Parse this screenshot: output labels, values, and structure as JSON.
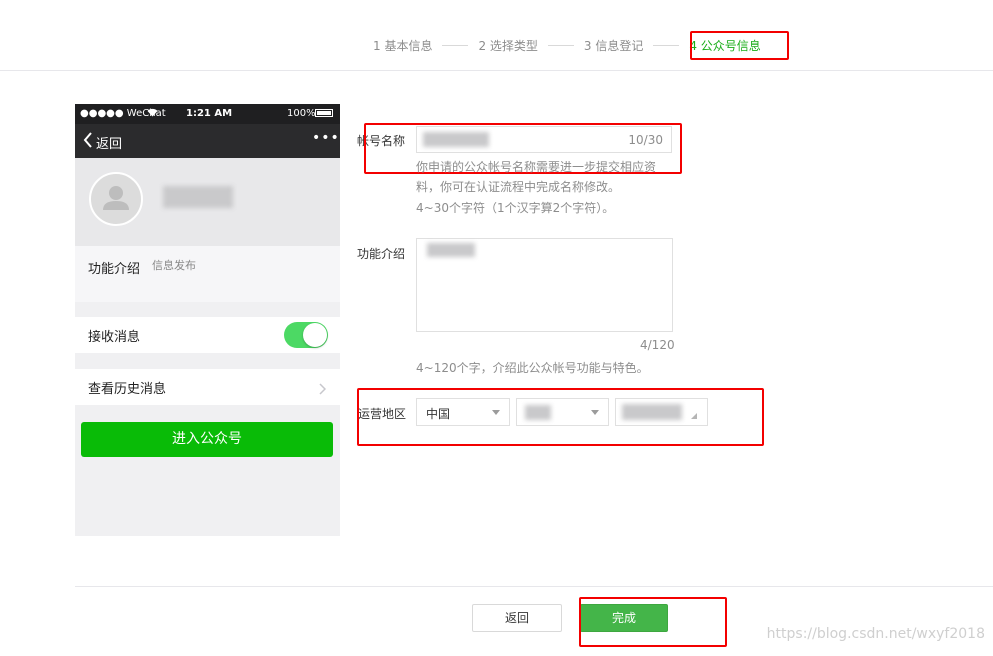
{
  "stepper": {
    "steps": [
      "1 基本信息",
      "2 选择类型",
      "3 信息登记",
      "4 公众号信息"
    ],
    "active_index": 3,
    "active_color": "#1aad19"
  },
  "phone": {
    "status_bar": {
      "carrier": "●●●●● WeChat",
      "time": "1:21 AM",
      "battery": "100%"
    },
    "nav": {
      "back_label": "返回",
      "more_icon": "more-icon"
    },
    "intro_label": "功能介绍",
    "intro_value": "信息发布",
    "receive_label": "接收消息",
    "receive_enabled": true,
    "history_label": "查看历史消息",
    "enter_button": "进入公众号"
  },
  "form": {
    "name_label": "帐号名称",
    "name_counter": "10/30",
    "name_hint_1": "你申请的公众帐号名称需要进一步提交相应资",
    "name_hint_2": "料，你可在认证流程中完成名称修改。",
    "name_rule": "4~30个字符（1个汉字算2个字符）。",
    "intro_label": "功能介绍",
    "intro_counter": "4/120",
    "intro_hint": "4~120个字，介绍此公众帐号功能与特色。",
    "region_label": "运营地区",
    "region_country": "中国"
  },
  "footer": {
    "back_button": "返回",
    "done_button": "完成",
    "done_color": "#44b549"
  },
  "watermark": "https://blog.csdn.net/wxyf2018",
  "colors": {
    "annotation_red": "#f30000",
    "toggle_on": "#4cd964",
    "enter_green": "#09bb07"
  }
}
